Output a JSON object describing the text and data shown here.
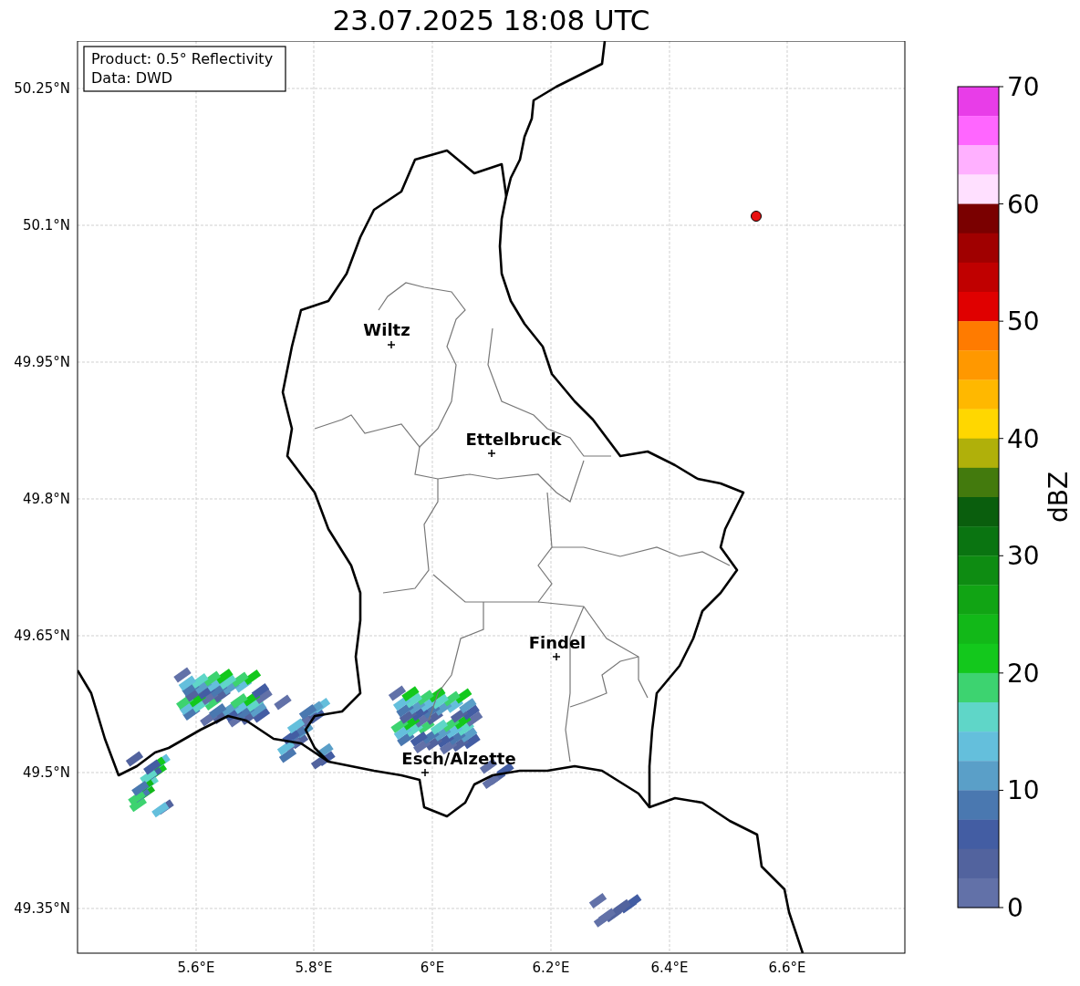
{
  "title": "23.07.2025 18:08 UTC",
  "info_box": {
    "lines": [
      "Product: 0.5° Reflectivity",
      "Data: DWD"
    ]
  },
  "map": {
    "lat_ticks": [
      "50.25°N",
      "50.1°N",
      "49.95°N",
      "49.8°N",
      "49.65°N",
      "49.5°N",
      "49.35°N"
    ],
    "lon_ticks": [
      "5.6°E",
      "5.8°E",
      "6°E",
      "6.2°E",
      "6.4°E",
      "6.6°E"
    ],
    "cities": [
      {
        "name": "Wiltz"
      },
      {
        "name": "Ettelbruck"
      },
      {
        "name": "Findel"
      },
      {
        "name": "Esch/Alzette"
      }
    ],
    "radar_site": {
      "color": "#e81010"
    }
  },
  "colorbar": {
    "label": "dBZ",
    "ticks": [
      "70",
      "60",
      "50",
      "40",
      "30",
      "20",
      "10",
      "0"
    ],
    "bins": [
      {
        "color": "#e83de8"
      },
      {
        "color": "#ff66ff"
      },
      {
        "color": "#ffb0ff"
      },
      {
        "color": "#ffe0ff"
      },
      {
        "color": "#7a0000"
      },
      {
        "color": "#a00000"
      },
      {
        "color": "#c00000"
      },
      {
        "color": "#e00000"
      },
      {
        "color": "#ff7b00"
      },
      {
        "color": "#ff9800"
      },
      {
        "color": "#ffb800"
      },
      {
        "color": "#ffd700"
      },
      {
        "color": "#b0b00a"
      },
      {
        "color": "#437a0d"
      },
      {
        "color": "#0a5e0d"
      },
      {
        "color": "#0a7411"
      },
      {
        "color": "#0e8c12"
      },
      {
        "color": "#11a414"
      },
      {
        "color": "#12b818"
      },
      {
        "color": "#13c81c"
      },
      {
        "color": "#3dd370"
      },
      {
        "color": "#5fd6c8"
      },
      {
        "color": "#64bfdc"
      },
      {
        "color": "#5a9fc8"
      },
      {
        "color": "#4a78b0"
      },
      {
        "color": "#435da3"
      },
      {
        "color": "#52639e"
      },
      {
        "color": "#6271a8"
      }
    ]
  }
}
